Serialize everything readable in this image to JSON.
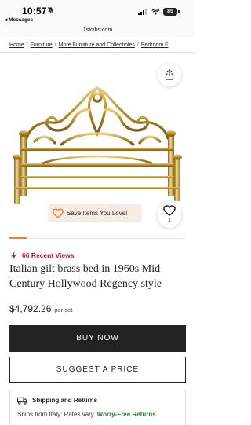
{
  "status_bar": {
    "time": "10:57",
    "back_label": "◂ Messages",
    "battery": "85"
  },
  "url_bar": {
    "domain": "1stdibs.com"
  },
  "breadcrumb": {
    "items": [
      "Home",
      "Furniture",
      "More Furniture and Collectibles",
      "Bedroom F"
    ]
  },
  "product": {
    "save_prompt": "Save Items You Love!",
    "favorite_count": "1",
    "image_progress": 0.1,
    "views": "66 Recent Views",
    "title": "Italian gilt brass bed in 1960s Mid Century Hollywood Regency style",
    "price": "$4,792.26",
    "price_unit": "per set"
  },
  "actions": {
    "buy_label": "BUY NOW",
    "suggest_label": "SUGGEST A PRICE"
  },
  "shipping": {
    "title": "Shipping and Returns",
    "line_prefix": "Ships from Italy: Rates vary.",
    "line_highlight": "Worry-Free Returns"
  },
  "colors": {
    "accent_orange": "#e8833a",
    "views_red": "#c8102e",
    "returns_green": "#2b7d43",
    "button_dark": "#222222"
  },
  "icons": [
    "bell-icon",
    "signal-icon",
    "wifi-icon",
    "share-icon",
    "heart-icon",
    "bolt-icon",
    "truck-icon"
  ]
}
